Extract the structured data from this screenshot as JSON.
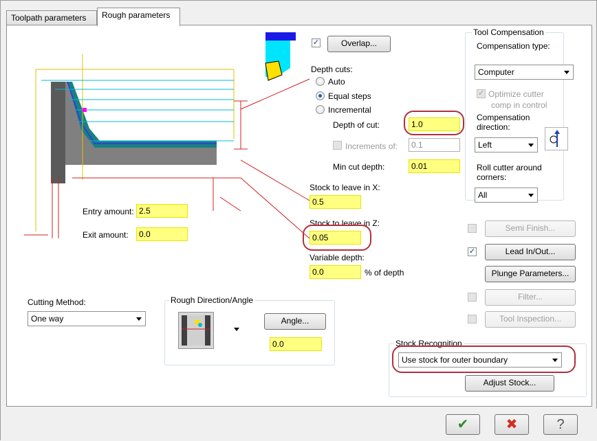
{
  "tabs": {
    "toolpath": "Toolpath parameters",
    "rough": "Rough parameters"
  },
  "overlap_label": "Overlap...",
  "depth_cuts": {
    "title": "Depth cuts:",
    "auto": "Auto",
    "equal_steps": "Equal steps",
    "incremental": "Incremental",
    "depth_of_cut_label": "Depth of cut:",
    "depth_of_cut": "1.0",
    "increments_label": "Increments of:",
    "increments": "0.1",
    "min_cut_label": "Min cut depth:",
    "min_cut": "0.01"
  },
  "stock": {
    "x_label": "Stock to leave in X:",
    "x_value": "0.5",
    "z_label": "Stock to leave in Z:",
    "z_value": "0.05",
    "variable_label": "Variable depth:",
    "variable_value": "0.0",
    "variable_unit": "% of depth"
  },
  "entry": {
    "label": "Entry amount:",
    "value": "2.5"
  },
  "exit": {
    "label": "Exit amount:",
    "value": "0.0"
  },
  "tool_comp": {
    "title": "Tool Compensation",
    "type_label": "Compensation type:",
    "type_value": "Computer",
    "optimize_label": "Optimize cutter",
    "optimize_sub": "comp in control",
    "direction_label": "Compensation direction:",
    "direction_value": "Left",
    "roll_label": "Roll cutter around corners:",
    "roll_value": "All"
  },
  "right_buttons": {
    "semi_finish": "Semi Finish...",
    "lead_inout": "Lead In/Out...",
    "plunge": "Plunge Parameters...",
    "filter": "Filter...",
    "tool_inspection": "Tool Inspection..."
  },
  "cutting_method": {
    "label": "Cutting Method:",
    "value": "One way"
  },
  "rough_direction": {
    "title": "Rough Direction/Angle",
    "angle_label": "Angle...",
    "angle_value": "0.0"
  },
  "stock_recognition": {
    "title": "Stock Recognition",
    "value": "Use stock for outer boundary",
    "adjust_label": "Adjust Stock..."
  },
  "colors": {
    "accent": "#ffff80",
    "highlight": "#b0303a",
    "ok": "#2e8b2e",
    "cancel": "#d62b1e"
  }
}
